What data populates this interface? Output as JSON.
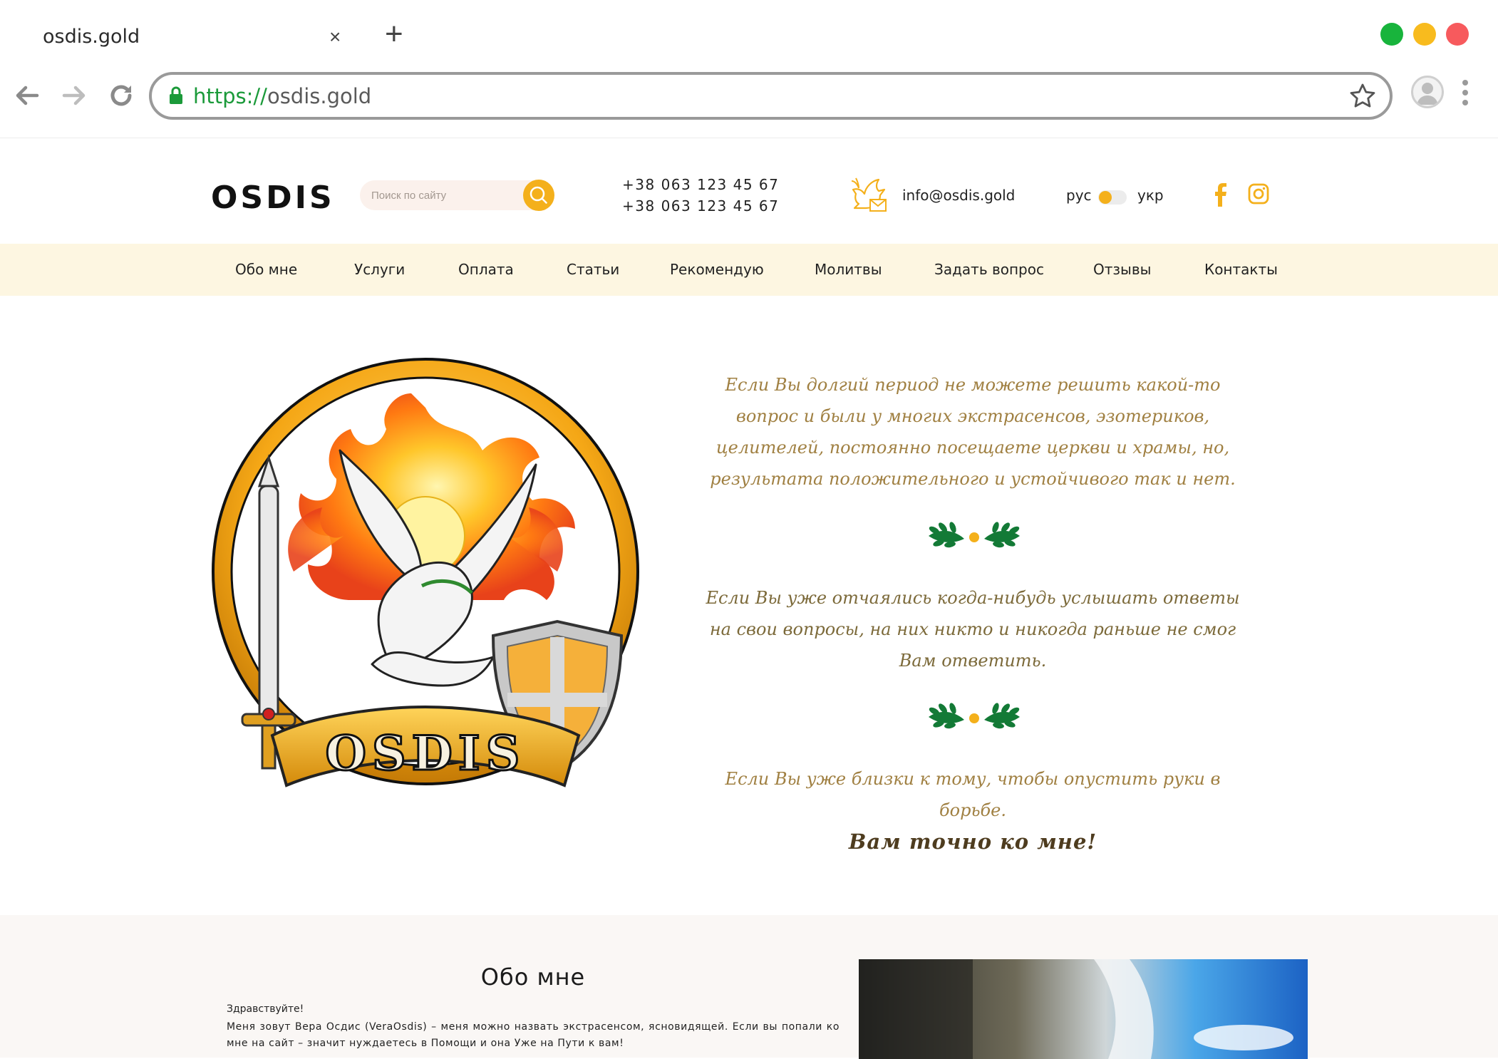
{
  "browser": {
    "tab_title": "osdis.gold",
    "tab_close": "×",
    "new_tab": "+",
    "url_protocol": "https://",
    "url_host": "osdis.gold"
  },
  "header": {
    "logo": "OSDIS",
    "search_placeholder": "Поиск по сайту",
    "phones": [
      "+38 063 123 45 67",
      "+38 063 123 45 67"
    ],
    "email": "info@osdis.gold",
    "lang_ru": "рус",
    "lang_uk": "укр",
    "accent_color": "#f4b01b"
  },
  "menu": {
    "items": [
      "Обо мне",
      "Услуги",
      "Оплата",
      "Статьи",
      "Рекомендую",
      "Молитвы",
      "Задать вопрос",
      "Отзывы",
      "Контакты"
    ]
  },
  "hero": {
    "emblem_text": "OSDIS",
    "p1": "Если Вы долгий период не можете решить какой-то вопрос и были у многих экстрасенсов, эзотериков, целителей, постоянно посещаете церкви и храмы, но, результата положительного и устойчивого так и нет.",
    "p2": "Если Вы уже отчаялись когда-нибудь услышать ответы на свои вопросы, на них никто и никогда раньше не смог Вам ответить.",
    "p3": "Если Вы уже близки к тому, чтобы опустить руки в борьбе.",
    "cta": "Вам точно ко мне!"
  },
  "about": {
    "title": "Обо мне",
    "greeting": "Здравствуйте!",
    "body": "Меня зовут Вера Осдис (VeraOsdis) – меня можно назвать экстрасенсом, ясновидящей. Если вы попали ко мне на сайт – значит нуждаетесь в Помощи и она Уже на Пути к вам!"
  }
}
